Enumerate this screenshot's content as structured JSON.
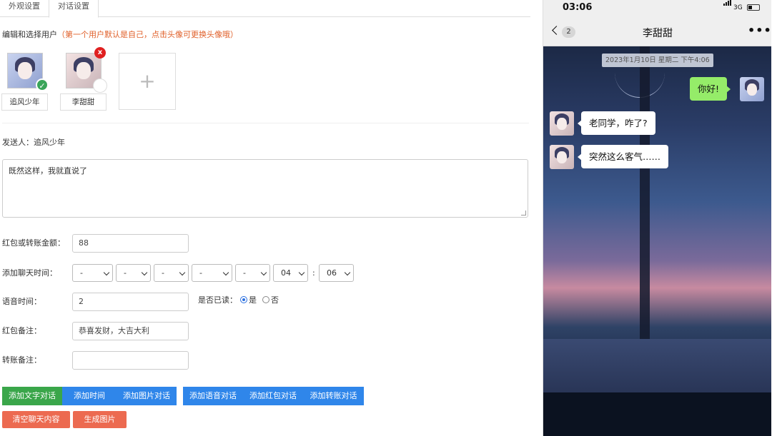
{
  "tabs": [
    {
      "label": "外观设置",
      "active": false
    },
    {
      "label": "对话设置",
      "active": true
    }
  ],
  "users": {
    "label": "编辑和选择用户",
    "hint": "（第一个用户默认是自己，点击头像可更换头像哦）",
    "list": [
      {
        "name": "追风少年",
        "selected": true
      },
      {
        "name": "李甜甜",
        "selected": false
      }
    ],
    "add_symbol": "+",
    "delete_symbol": "x",
    "check_symbol": "✓"
  },
  "sender": {
    "label": "发送人：",
    "name": "追风少年"
  },
  "message": {
    "text": "既然这样，我就直说了"
  },
  "form": {
    "amount": {
      "label": "红包或转账金额：",
      "value": "88"
    },
    "time": {
      "label": "添加聊天时间：",
      "selects": [
        "-",
        "-",
        "-",
        "-",
        "-",
        "04"
      ],
      "colon": ":",
      "minute": "06"
    },
    "voice": {
      "label": "语音时间：",
      "value": "2"
    },
    "read": {
      "label": "是否已读：",
      "yes": "是",
      "no": "否",
      "value": "是"
    },
    "redpacket_note": {
      "label": "红包备注：",
      "value": "恭喜发财，大吉大利"
    },
    "transfer_note": {
      "label": "转账备注：",
      "value": ""
    }
  },
  "buttons": {
    "add_text": "添加文字对话",
    "add_time": "添加时间",
    "add_image": "添加图片对话",
    "add_voice": "添加语音对话",
    "add_redpacket": "添加红包对话",
    "add_transfer": "添加转账对话",
    "clear": "清空聊天内容",
    "generate": "生成图片"
  },
  "colors": {
    "green": "#3aa64a",
    "blue": "#2f86ea",
    "red": "#ec6a50",
    "wechat_green": "#95ec69"
  },
  "phone": {
    "time": "03:06",
    "network": "3G",
    "unread": "2",
    "title": "李甜甜",
    "more": "•••",
    "timestamp": "2023年1月10日 星期二 下午4:06",
    "messages": [
      {
        "from": "me",
        "text": "你好!"
      },
      {
        "from": "them",
        "text": "老同学，咋了?"
      },
      {
        "from": "them",
        "text": "突然这么客气……"
      }
    ]
  }
}
